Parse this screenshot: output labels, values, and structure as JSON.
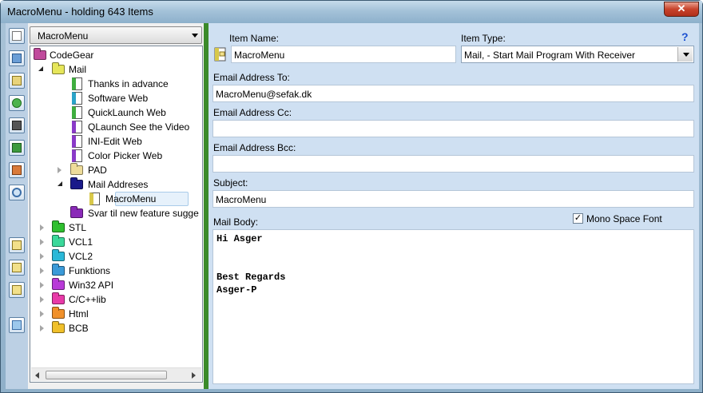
{
  "window": {
    "title": "MacroMenu - holding 643 Items",
    "close_glyph": "✕"
  },
  "toolbar": {
    "icons": [
      "new-item-icon",
      "open-folder-icon",
      "export-icon",
      "refresh-icon",
      "save-icon",
      "edit-icon",
      "properties-icon",
      "search-icon",
      "move-up-icon",
      "import-icon",
      "move-down-icon",
      "recycle-icon"
    ]
  },
  "tree": {
    "root_selector": "MacroMenu",
    "nodes": [
      {
        "label": "CodeGear"
      },
      {
        "label": "Mail"
      },
      {
        "label": "Thanks in advance"
      },
      {
        "label": "Software Web"
      },
      {
        "label": "QuickLaunch Web"
      },
      {
        "label": "QLaunch See the Video"
      },
      {
        "label": "INI-Edit Web"
      },
      {
        "label": "Color Picker Web"
      },
      {
        "label": "PAD"
      },
      {
        "label": "Mail Addreses"
      },
      {
        "label": "MacroMenu"
      },
      {
        "label": "Svar til new feature sugge"
      },
      {
        "label": "STL"
      },
      {
        "label": "VCL1"
      },
      {
        "label": "VCL2"
      },
      {
        "label": "Funktions"
      },
      {
        "label": "Win32 API"
      },
      {
        "label": "C/C++lib"
      },
      {
        "label": "Html"
      },
      {
        "label": "BCB"
      }
    ]
  },
  "form": {
    "item_name_label": "Item Name:",
    "item_name_value": "MacroMenu",
    "item_type_label": "Item Type:",
    "item_type_value": "Mail, - Start Mail Program With Receiver",
    "help_glyph": "?",
    "to_label": "Email Address  To:",
    "to_value": "MacroMenu@sefak.dk",
    "cc_label": "Email Address  Cc:",
    "cc_value": "",
    "bcc_label": "Email Address  Bcc:",
    "bcc_value": "",
    "subject_label": "Subject:",
    "subject_value": "MacroMenu",
    "body_label": "Mail Body:",
    "mono_label": "Mono Space Font",
    "mono_checked_glyph": "✓",
    "body_lines": [
      "Hi Asger",
      "",
      "",
      "Best Regards",
      "Asger-P"
    ]
  }
}
